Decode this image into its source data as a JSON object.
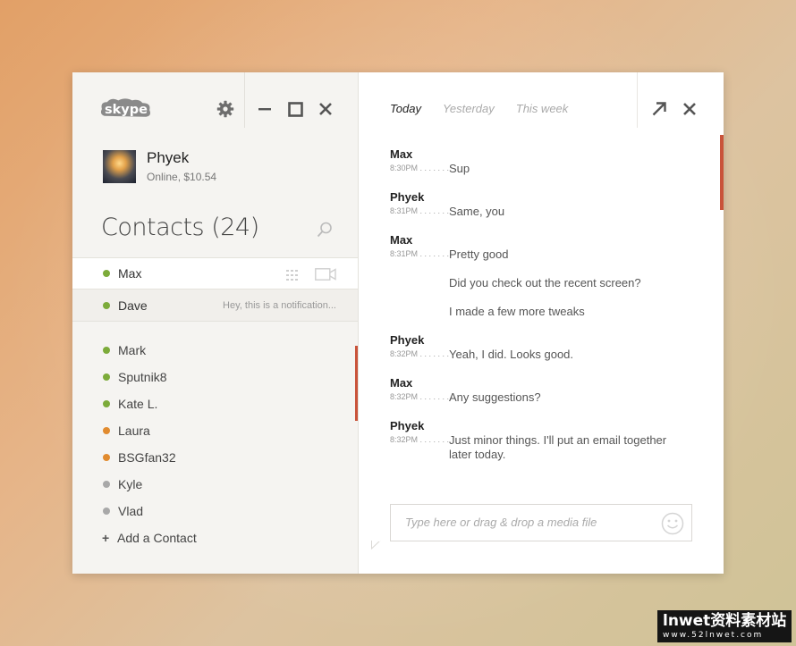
{
  "app": {
    "logo_text": "skype"
  },
  "profile": {
    "name": "Phyek",
    "status": "Online, $10.54"
  },
  "contacts": {
    "title": "Contacts (24)",
    "pinned": [
      {
        "name": "Max",
        "status": "online"
      },
      {
        "name": "Dave",
        "status": "online",
        "note": "Hey, this is a notification..."
      }
    ],
    "list": [
      {
        "name": "Mark",
        "status": "online"
      },
      {
        "name": "Sputnik8",
        "status": "online"
      },
      {
        "name": "Kate L.",
        "status": "online"
      },
      {
        "name": "Laura",
        "status": "away"
      },
      {
        "name": "BSGfan32",
        "status": "away"
      },
      {
        "name": "Kyle",
        "status": "offline"
      },
      {
        "name": "Vlad",
        "status": "offline"
      }
    ],
    "add_label": "Add a Contact"
  },
  "status_colors": {
    "online": "#7cab3a",
    "away": "#e18b2f",
    "offline": "#a8a8a8"
  },
  "accent_color": "#c9533a",
  "chat": {
    "tabs": [
      {
        "label": "Today",
        "active": true
      },
      {
        "label": "Yesterday",
        "active": false
      },
      {
        "label": "This week",
        "active": false
      }
    ],
    "messages": [
      {
        "sender": "Max",
        "time": "8:30PM",
        "lines": [
          "Sup"
        ]
      },
      {
        "sender": "Phyek",
        "time": "8:31PM",
        "lines": [
          "Same, you"
        ]
      },
      {
        "sender": "Max",
        "time": "8:31PM",
        "lines": [
          "Pretty good",
          "Did you check out the recent screen?",
          "I made a few more tweaks"
        ]
      },
      {
        "sender": "Phyek",
        "time": "8:32PM",
        "lines": [
          "Yeah, I did. Looks good."
        ]
      },
      {
        "sender": "Max",
        "time": "8:32PM",
        "lines": [
          "Any suggestions?"
        ]
      },
      {
        "sender": "Phyek",
        "time": "8:32PM",
        "lines": [
          "Just minor things. I'll put an email together later today."
        ]
      }
    ],
    "input_placeholder": "Type here or drag & drop a media file"
  },
  "icons": {
    "settings": "gear-icon",
    "minimize": "minimize-icon",
    "maximize": "maximize-icon",
    "close": "close-icon",
    "search": "search-icon",
    "dialpad": "dialpad-icon",
    "video": "video-call-icon",
    "popout": "popout-arrow-icon",
    "emoji": "smiley-icon"
  },
  "watermark": {
    "title": "lnwet资料素材站",
    "url": "www.52lnwet.com"
  }
}
